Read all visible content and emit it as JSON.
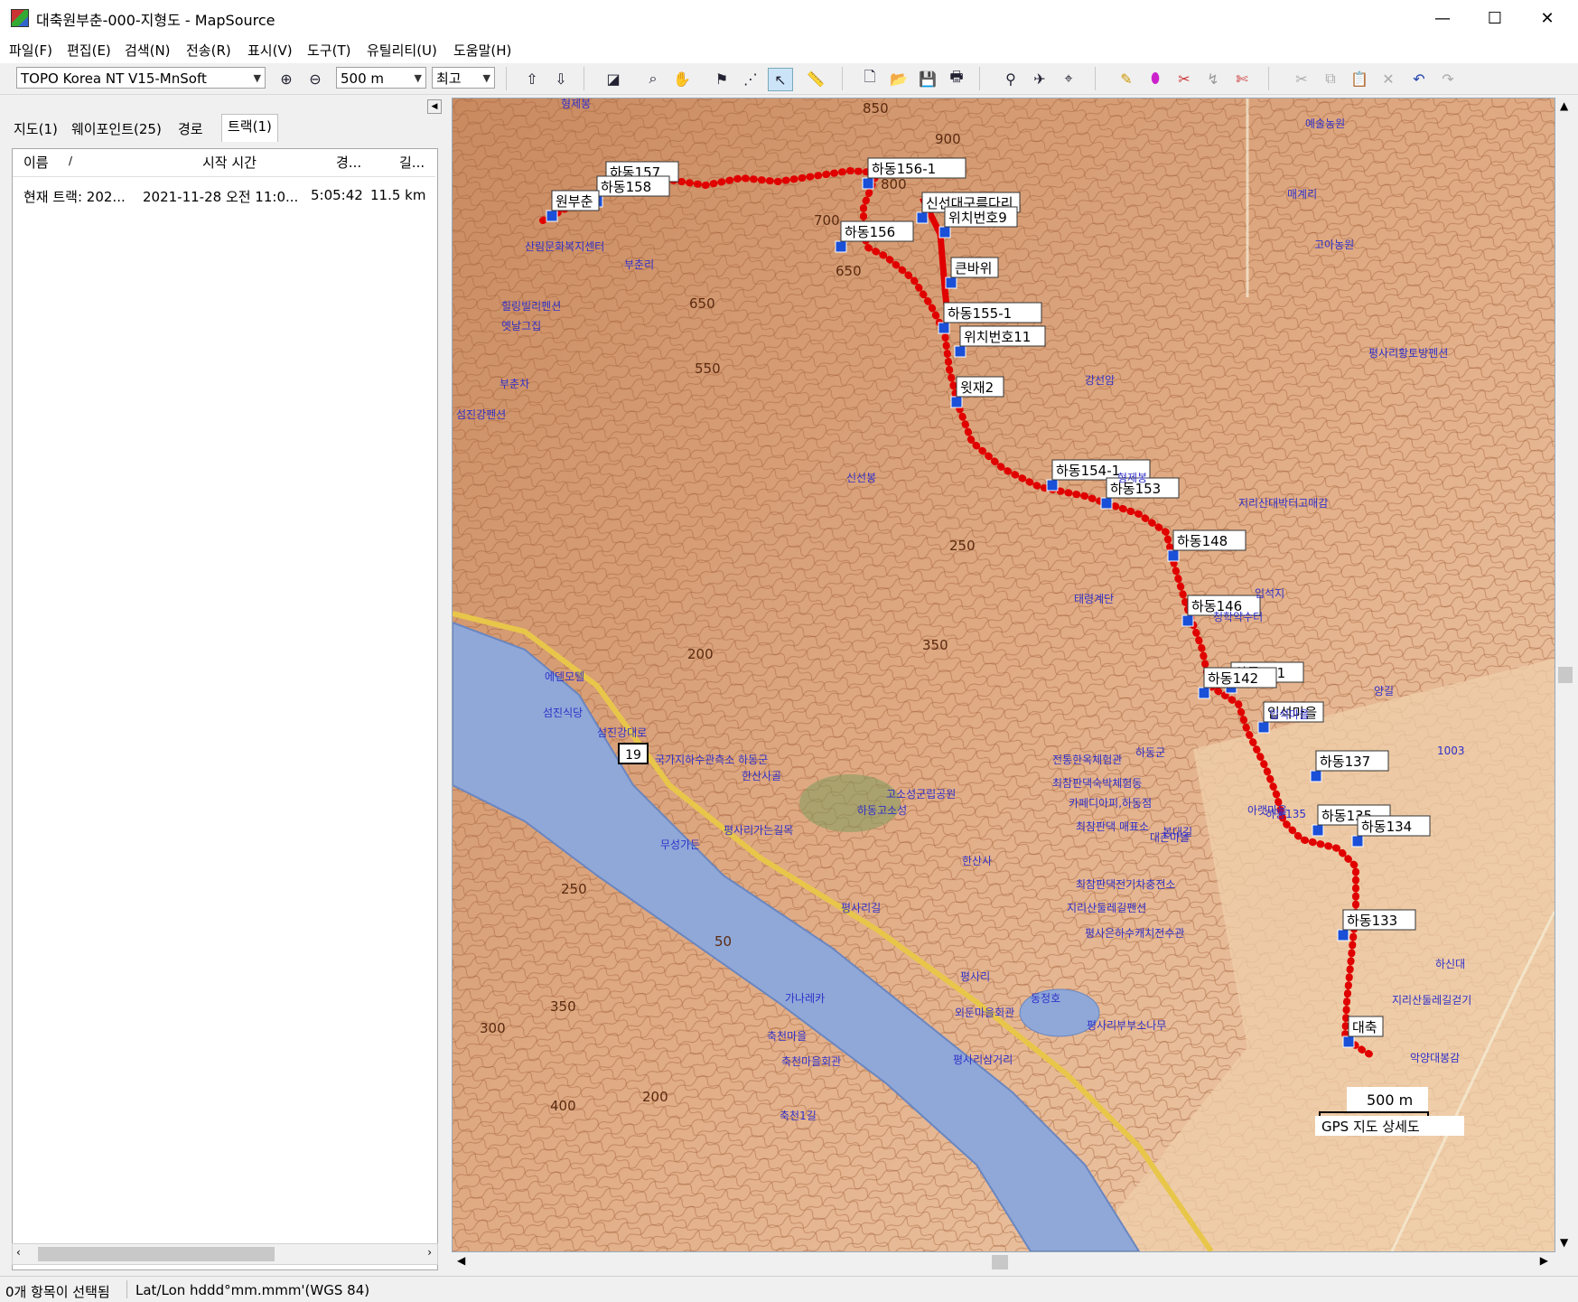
{
  "window": {
    "title": "대축원부춘-000-지형도 - MapSource"
  },
  "menu": [
    "파일(F)",
    "편집(E)",
    "검색(N)",
    "전송(R)",
    "표시(V)",
    "도구(T)",
    "유틸리티(U)",
    "도움말(H)"
  ],
  "toolbar": {
    "map_product": "TOPO Korea NT V15-MnSoft",
    "zoom_scale": "500 m",
    "detail": "최고"
  },
  "left_panel": {
    "tabs": [
      "지도(1)",
      "웨이포인트(25)",
      "경로",
      "트랙(1)"
    ],
    "columns": [
      "이름",
      "/",
      "시작 시간",
      "경...",
      "길..."
    ],
    "rows": [
      [
        "현재 트랙: 202...",
        "2021-11-28 오전 11:0...",
        "5:05:42",
        "11.5 km"
      ]
    ]
  },
  "map": {
    "waypoints": [
      "하동157",
      "하동158",
      "원부춘",
      "하동156-1",
      "신선대구름다리",
      "위치번호9",
      "하동156",
      "큰바위",
      "하동155-1",
      "위치번호11",
      "윗재2",
      "하동154-1",
      "하동153",
      "하동148",
      "하동146",
      "하동141",
      "하동142",
      "입석마을",
      "하동137",
      "하동135",
      "하동134",
      "하동133",
      "대축"
    ],
    "contours": [
      "850",
      "900",
      "800",
      "700",
      "650",
      "650",
      "550",
      "350",
      "200",
      "250",
      "50",
      "350",
      "300",
      "400",
      "200",
      "250"
    ],
    "places": [
      "부춘리",
      "산림문화복지센터",
      "힐링빌리펜션",
      "옛날그집",
      "부춘차",
      "섬진강펜션",
      "형제봉",
      "강선암",
      "신선봉",
      "형제봉",
      "지리산대박터고매감",
      "입석지",
      "청학약수터",
      "태령계단",
      "예술농원",
      "매계리",
      "고아농원",
      "평사리황토방펜션",
      "에덴모텔",
      "섬진식당",
      "섬진강대로",
      "국가지하수관측소 하동군",
      "한산사골",
      "고소성군립공원",
      "하동고소성",
      "평사리가는길목",
      "무성가든",
      "전통한옥체험관",
      "최참판댁숙박체험동",
      "카페디아피,하동점",
      "최참판댁 매표소",
      "봉대길",
      "대촌마을",
      "한산사",
      "최참판댁전기차충전소",
      "지리산둘레길펜션",
      "평사리길",
      "평사은하수캐치전수관",
      "평사리",
      "동정호",
      "외둔마을회관",
      "평사리부부소나무",
      "평사리삼거리",
      "가나레카",
      "축천마을",
      "축천마을회관",
      "축천1길",
      "지리산둘레길걷기",
      "악양대봉감",
      "하신대",
      "입석마을",
      "하동군",
      "양길",
      "아랫마을",
      "하동135",
      "1003"
    ],
    "route_number": "19",
    "scale_label": "500 m",
    "map_name": "GPS 지도 상세도"
  },
  "status": {
    "selection": "0개 항목이 선택됨",
    "coord_format": "Lat/Lon hddd°mm.mmm'(WGS 84)"
  },
  "colors": {
    "track": "#e00000",
    "water": "#8fa8d8",
    "terrain": "#d9a27a",
    "road": "#f2e89a"
  }
}
